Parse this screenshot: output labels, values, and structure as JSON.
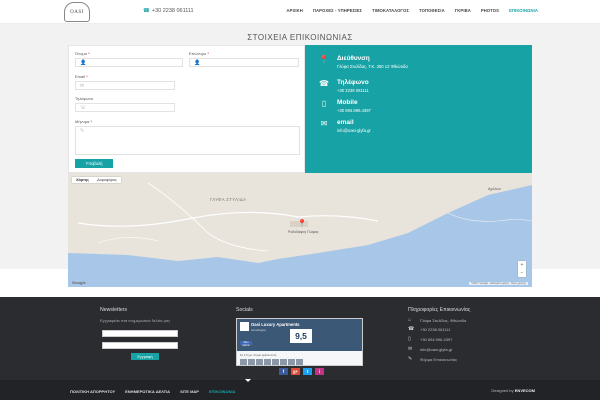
{
  "header": {
    "logo_text": "OASI",
    "phone": "+30 2238 061111",
    "nav": [
      {
        "label": "ΑΡΧΙΚΗ",
        "active": false
      },
      {
        "label": "ΠΑΡΟΧΕΣ - ΥΠΗΡΕΣΙΕΣ",
        "active": false
      },
      {
        "label": "ΤΙΜΟΚΑΤΑΛΟΓΟΣ",
        "active": false
      },
      {
        "label": "ΤΟΠΟΘΕΣΙΑ",
        "active": false
      },
      {
        "label": "ΓΚΡΙΒΑ",
        "active": false
      },
      {
        "label": "PHOTOS",
        "active": false
      },
      {
        "label": "ΕΠΙΚΟΙΝΩΝΙΑ",
        "active": true
      }
    ]
  },
  "page_title": "ΣΤΟΙΧΕΙΑ ΕΠΙΚΟΙΝΩΝΙΑΣ",
  "form": {
    "first_name_label": "Όνομα",
    "last_name_label": "Επώνυμο",
    "email_label": "Email",
    "phone_label": "Τηλέφωνο",
    "message_label": "Μήνυμα",
    "required_mark": "*",
    "submit_label": "Υποβολή"
  },
  "info": {
    "address_title": "Διεύθυνση",
    "address_text": "Γλύφα Στυλίδας, Τ.Κ. 350 12 Φθιώτιδα",
    "phone_title": "Τηλέφωνο",
    "phone_text": "+30 2238 061111",
    "mobile_title": "Mobile",
    "mobile_text": "+30 694.996.4397",
    "email_title": "email",
    "email_text": "info@oasi-glyfa.gr"
  },
  "map": {
    "toggle_map": "Χάρτης",
    "toggle_satellite": "Δορυφόρος",
    "region_label": "ΓΛΥΦΑ ΣΤΥΛΙΔΑ",
    "town_label": "Ροδοδάφνη Γλύφας",
    "town2_label": "Αχιλλειο",
    "google": "Google",
    "terms": "©2017 Google · Δεδομένα χάρτη · Όροι χρήσης"
  },
  "footer": {
    "newsletter_title": "Newsletters",
    "newsletter_text": "Εγγραφείτε στα ενημερωτικά δελτία μας",
    "subscribe_label": "Εγγραφή",
    "socials_title": "Socials",
    "fb_name": "Oasi Luxury Apartments",
    "fb_sub": "Ξενοδοχείο",
    "fb_score": "9,5",
    "fb_like": "Μου αρέσει",
    "fb_count": "Σε 1,5 χιλ. άτομα αρέσει αυτή",
    "social_icons": [
      "f",
      "g+",
      "t",
      "i"
    ],
    "contact_title": "Πληροφορίες Επικοινωνίας",
    "contact_rows": [
      {
        "icon": "home-icon",
        "text": "Γλύφα Στυλίδας, Φθιώτιδα"
      },
      {
        "icon": "phone-icon",
        "text": "+30 2238 061111"
      },
      {
        "icon": "mobile-icon",
        "text": "+30 694.996.4397"
      },
      {
        "icon": "mail-icon",
        "text": "info@oasi-glyfa.gr"
      },
      {
        "icon": "link-icon",
        "text": "Φόρμα Επικοινωνίας"
      }
    ]
  },
  "bottom_bar": {
    "links": [
      {
        "label": "ΠΟΛΙΤΙΚΗ ΑΠΟΡΡΗΤΟΥ",
        "active": false
      },
      {
        "label": "ΕΝΗΜΕΡΩΤΙΚΑ ΔΕΛΤΙΑ",
        "active": false
      },
      {
        "label": "SITE MAP",
        "active": false
      },
      {
        "label": "ΕΠΙΚΟΙΝΩΝΙΑ",
        "active": true
      }
    ],
    "designed_by": "Designed by",
    "designer": "ENVECOM"
  },
  "colors": {
    "accent": "#17a2a6",
    "footer_bg": "#2b2c30",
    "bottom_bg": "#222327",
    "band_bg": "#f2f2f2"
  }
}
